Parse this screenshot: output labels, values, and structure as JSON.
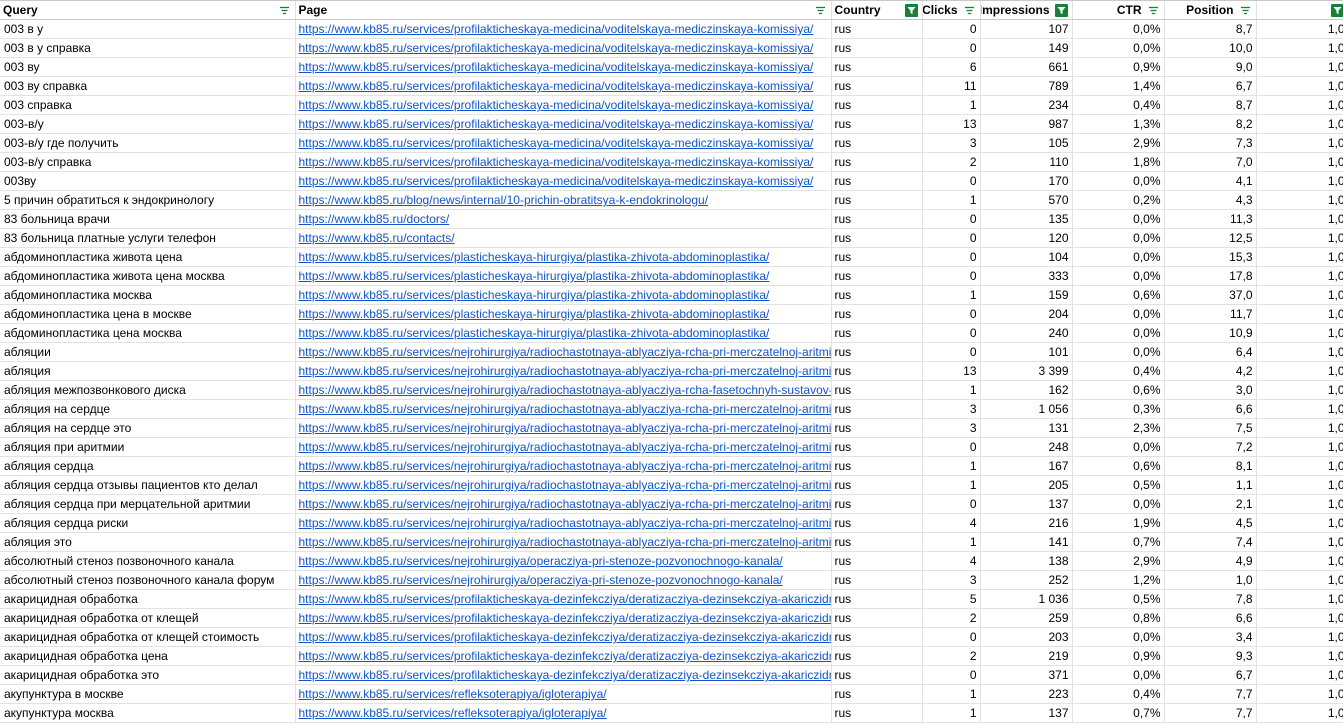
{
  "headers": {
    "query": "Query",
    "page": "Page",
    "country": "Country",
    "clicks": "Clicks",
    "impressions": "Impressions",
    "ctr": "CTR",
    "position": "Position",
    "extra": ""
  },
  "filter_states": {
    "query": "inactive",
    "page": "inactive",
    "country": "active",
    "clicks": "inactive",
    "impressions": "active",
    "ctr": "inactive",
    "position": "inactive",
    "extra": "active"
  },
  "colors": {
    "link": "#1155cc",
    "filter_active": "#188038",
    "filter_inactive": "#188038",
    "grid": "#e2e2e2"
  },
  "rows": [
    {
      "query": "003 в у",
      "page": "https://www.kb85.ru/services/profilakticheskaya-medicina/voditelskaya-mediczinskaya-komissiya/",
      "country": "rus",
      "clicks": "0",
      "impressions": "107",
      "ctr": "0,0%",
      "position": "8,7",
      "extra": "1,0"
    },
    {
      "query": "003 в у справка",
      "page": "https://www.kb85.ru/services/profilakticheskaya-medicina/voditelskaya-mediczinskaya-komissiya/",
      "country": "rus",
      "clicks": "0",
      "impressions": "149",
      "ctr": "0,0%",
      "position": "10,0",
      "extra": "1,0"
    },
    {
      "query": "003 ву",
      "page": "https://www.kb85.ru/services/profilakticheskaya-medicina/voditelskaya-mediczinskaya-komissiya/",
      "country": "rus",
      "clicks": "6",
      "impressions": "661",
      "ctr": "0,9%",
      "position": "9,0",
      "extra": "1,0"
    },
    {
      "query": "003 ву справка",
      "page": "https://www.kb85.ru/services/profilakticheskaya-medicina/voditelskaya-mediczinskaya-komissiya/",
      "country": "rus",
      "clicks": "11",
      "impressions": "789",
      "ctr": "1,4%",
      "position": "6,7",
      "extra": "1,0"
    },
    {
      "query": "003 справка",
      "page": "https://www.kb85.ru/services/profilakticheskaya-medicina/voditelskaya-mediczinskaya-komissiya/",
      "country": "rus",
      "clicks": "1",
      "impressions": "234",
      "ctr": "0,4%",
      "position": "8,7",
      "extra": "1,0"
    },
    {
      "query": "003-в/у",
      "page": "https://www.kb85.ru/services/profilakticheskaya-medicina/voditelskaya-mediczinskaya-komissiya/",
      "country": "rus",
      "clicks": "13",
      "impressions": "987",
      "ctr": "1,3%",
      "position": "8,2",
      "extra": "1,0"
    },
    {
      "query": "003-в/у где получить",
      "page": "https://www.kb85.ru/services/profilakticheskaya-medicina/voditelskaya-mediczinskaya-komissiya/",
      "country": "rus",
      "clicks": "3",
      "impressions": "105",
      "ctr": "2,9%",
      "position": "7,3",
      "extra": "1,0"
    },
    {
      "query": "003-в/у справка",
      "page": "https://www.kb85.ru/services/profilakticheskaya-medicina/voditelskaya-mediczinskaya-komissiya/",
      "country": "rus",
      "clicks": "2",
      "impressions": "110",
      "ctr": "1,8%",
      "position": "7,0",
      "extra": "1,0"
    },
    {
      "query": "003ву",
      "page": "https://www.kb85.ru/services/profilakticheskaya-medicina/voditelskaya-mediczinskaya-komissiya/",
      "country": "rus",
      "clicks": "0",
      "impressions": "170",
      "ctr": "0,0%",
      "position": "4,1",
      "extra": "1,0"
    },
    {
      "query": "5 причин обратиться к эндокринологу",
      "page": "https://www.kb85.ru/blog/news/internal/10-prichin-obratitsya-k-endokrinologu/",
      "country": "rus",
      "clicks": "1",
      "impressions": "570",
      "ctr": "0,2%",
      "position": "4,3",
      "extra": "1,0"
    },
    {
      "query": "83 больница врачи",
      "page": "https://www.kb85.ru/doctors/",
      "country": "rus",
      "clicks": "0",
      "impressions": "135",
      "ctr": "0,0%",
      "position": "11,3",
      "extra": "1,0"
    },
    {
      "query": "83 больница платные услуги телефон",
      "page": "https://www.kb85.ru/contacts/",
      "country": "rus",
      "clicks": "0",
      "impressions": "120",
      "ctr": "0,0%",
      "position": "12,5",
      "extra": "1,0"
    },
    {
      "query": "абдоминопластика живота цена",
      "page": "https://www.kb85.ru/services/plasticheskaya-hirurgiya/plastika-zhivota-abdominoplastika/",
      "country": "rus",
      "clicks": "0",
      "impressions": "104",
      "ctr": "0,0%",
      "position": "15,3",
      "extra": "1,0"
    },
    {
      "query": "абдоминопластика живота цена москва",
      "page": "https://www.kb85.ru/services/plasticheskaya-hirurgiya/plastika-zhivota-abdominoplastika/",
      "country": "rus",
      "clicks": "0",
      "impressions": "333",
      "ctr": "0,0%",
      "position": "17,8",
      "extra": "1,0"
    },
    {
      "query": "абдоминопластика москва",
      "page": "https://www.kb85.ru/services/plasticheskaya-hirurgiya/plastika-zhivota-abdominoplastika/",
      "country": "rus",
      "clicks": "1",
      "impressions": "159",
      "ctr": "0,6%",
      "position": "37,0",
      "extra": "1,0"
    },
    {
      "query": "абдоминопластика цена в москве",
      "page": "https://www.kb85.ru/services/plasticheskaya-hirurgiya/plastika-zhivota-abdominoplastika/",
      "country": "rus",
      "clicks": "0",
      "impressions": "204",
      "ctr": "0,0%",
      "position": "11,7",
      "extra": "1,0"
    },
    {
      "query": "абдоминопластика цена москва",
      "page": "https://www.kb85.ru/services/plasticheskaya-hirurgiya/plastika-zhivota-abdominoplastika/",
      "country": "rus",
      "clicks": "0",
      "impressions": "240",
      "ctr": "0,0%",
      "position": "10,9",
      "extra": "1,0"
    },
    {
      "query": "абляции",
      "page": "https://www.kb85.ru/services/nejrohirurgiya/radiochastotnaya-ablyacziya-rcha-pri-merczatelnoj-aritmi",
      "country": "rus",
      "clicks": "0",
      "impressions": "101",
      "ctr": "0,0%",
      "position": "6,4",
      "extra": "1,0"
    },
    {
      "query": "абляция",
      "page": "https://www.kb85.ru/services/nejrohirurgiya/radiochastotnaya-ablyacziya-rcha-pri-merczatelnoj-aritmi",
      "country": "rus",
      "clicks": "13",
      "impressions": "3 399",
      "ctr": "0,4%",
      "position": "4,2",
      "extra": "1,0"
    },
    {
      "query": "абляция межпозвонкового диска",
      "page": "https://www.kb85.ru/services/nejrohirurgiya/radiochastotnaya-ablyacziya-rcha-fasetochnyh-sustavov-",
      "country": "rus",
      "clicks": "1",
      "impressions": "162",
      "ctr": "0,6%",
      "position": "3,0",
      "extra": "1,0"
    },
    {
      "query": "абляция на сердце",
      "page": "https://www.kb85.ru/services/nejrohirurgiya/radiochastotnaya-ablyacziya-rcha-pri-merczatelnoj-aritmi",
      "country": "rus",
      "clicks": "3",
      "impressions": "1 056",
      "ctr": "0,3%",
      "position": "6,6",
      "extra": "1,0"
    },
    {
      "query": "абляция на сердце это",
      "page": "https://www.kb85.ru/services/nejrohirurgiya/radiochastotnaya-ablyacziya-rcha-pri-merczatelnoj-aritmi",
      "country": "rus",
      "clicks": "3",
      "impressions": "131",
      "ctr": "2,3%",
      "position": "7,5",
      "extra": "1,0"
    },
    {
      "query": "абляция при аритмии",
      "page": "https://www.kb85.ru/services/nejrohirurgiya/radiochastotnaya-ablyacziya-rcha-pri-merczatelnoj-aritmi",
      "country": "rus",
      "clicks": "0",
      "impressions": "248",
      "ctr": "0,0%",
      "position": "7,2",
      "extra": "1,0"
    },
    {
      "query": "абляция сердца",
      "page": "https://www.kb85.ru/services/nejrohirurgiya/radiochastotnaya-ablyacziya-rcha-pri-merczatelnoj-aritmi",
      "country": "rus",
      "clicks": "1",
      "impressions": "167",
      "ctr": "0,6%",
      "position": "8,1",
      "extra": "1,0"
    },
    {
      "query": "абляция сердца отзывы пациентов кто делал",
      "page": "https://www.kb85.ru/services/nejrohirurgiya/radiochastotnaya-ablyacziya-rcha-pri-merczatelnoj-aritmi",
      "country": "rus",
      "clicks": "1",
      "impressions": "205",
      "ctr": "0,5%",
      "position": "1,1",
      "extra": "1,0"
    },
    {
      "query": "абляция сердца при мерцательной аритмии",
      "page": "https://www.kb85.ru/services/nejrohirurgiya/radiochastotnaya-ablyacziya-rcha-pri-merczatelnoj-aritmi",
      "country": "rus",
      "clicks": "0",
      "impressions": "137",
      "ctr": "0,0%",
      "position": "2,1",
      "extra": "1,0"
    },
    {
      "query": "абляция сердца риски",
      "page": "https://www.kb85.ru/services/nejrohirurgiya/radiochastotnaya-ablyacziya-rcha-pri-merczatelnoj-aritmi",
      "country": "rus",
      "clicks": "4",
      "impressions": "216",
      "ctr": "1,9%",
      "position": "4,5",
      "extra": "1,0"
    },
    {
      "query": "абляция это",
      "page": "https://www.kb85.ru/services/nejrohirurgiya/radiochastotnaya-ablyacziya-rcha-pri-merczatelnoj-aritmi",
      "country": "rus",
      "clicks": "1",
      "impressions": "141",
      "ctr": "0,7%",
      "position": "7,4",
      "extra": "1,0"
    },
    {
      "query": "абсолютный стеноз позвоночного канала",
      "page": "https://www.kb85.ru/services/nejrohirurgiya/operacziya-pri-stenoze-pozvonochnogo-kanala/",
      "country": "rus",
      "clicks": "4",
      "impressions": "138",
      "ctr": "2,9%",
      "position": "4,9",
      "extra": "1,0"
    },
    {
      "query": "абсолютный стеноз позвоночного канала форум",
      "page": "https://www.kb85.ru/services/nejrohirurgiya/operacziya-pri-stenoze-pozvonochnogo-kanala/",
      "country": "rus",
      "clicks": "3",
      "impressions": "252",
      "ctr": "1,2%",
      "position": "1,0",
      "extra": "1,0"
    },
    {
      "query": "акарицидная обработка",
      "page": "https://www.kb85.ru/services/profilakticheskaya-dezinfekcziya/deratizacziya-dezinsekcziya-akariczidn",
      "country": "rus",
      "clicks": "5",
      "impressions": "1 036",
      "ctr": "0,5%",
      "position": "7,8",
      "extra": "1,0"
    },
    {
      "query": "акарицидная обработка от клещей",
      "page": "https://www.kb85.ru/services/profilakticheskaya-dezinfekcziya/deratizacziya-dezinsekcziya-akariczidn",
      "country": "rus",
      "clicks": "2",
      "impressions": "259",
      "ctr": "0,8%",
      "position": "6,6",
      "extra": "1,0"
    },
    {
      "query": "акарицидная обработка от клещей стоимость",
      "page": "https://www.kb85.ru/services/profilakticheskaya-dezinfekcziya/deratizacziya-dezinsekcziya-akariczidn",
      "country": "rus",
      "clicks": "0",
      "impressions": "203",
      "ctr": "0,0%",
      "position": "3,4",
      "extra": "1,0"
    },
    {
      "query": "акарицидная обработка цена",
      "page": "https://www.kb85.ru/services/profilakticheskaya-dezinfekcziya/deratizacziya-dezinsekcziya-akariczidn",
      "country": "rus",
      "clicks": "2",
      "impressions": "219",
      "ctr": "0,9%",
      "position": "9,3",
      "extra": "1,0"
    },
    {
      "query": "акарицидная обработка это",
      "page": "https://www.kb85.ru/services/profilakticheskaya-dezinfekcziya/deratizacziya-dezinsekcziya-akariczidn",
      "country": "rus",
      "clicks": "0",
      "impressions": "371",
      "ctr": "0,0%",
      "position": "6,7",
      "extra": "1,0"
    },
    {
      "query": "акупунктура в москве",
      "page": "https://www.kb85.ru/services/refleksoterapiya/igloterapiya/",
      "country": "rus",
      "clicks": "1",
      "impressions": "223",
      "ctr": "0,4%",
      "position": "7,7",
      "extra": "1,0"
    },
    {
      "query": "акупунктура москва",
      "page": "https://www.kb85.ru/services/refleksoterapiya/igloterapiya/",
      "country": "rus",
      "clicks": "1",
      "impressions": "137",
      "ctr": "0,7%",
      "position": "7,7",
      "extra": "1,0"
    }
  ]
}
